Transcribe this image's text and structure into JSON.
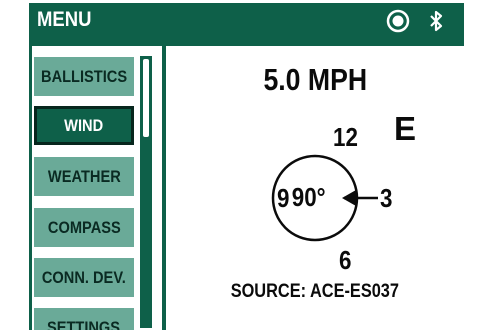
{
  "header": {
    "title": "MENU",
    "icons": [
      "record-icon",
      "bluetooth-icon"
    ]
  },
  "sidebar": {
    "items": [
      {
        "label": "BALLISTICS",
        "selected": false
      },
      {
        "label": "WIND",
        "selected": true
      },
      {
        "label": "WEATHER",
        "selected": false
      },
      {
        "label": "COMPASS",
        "selected": false
      },
      {
        "label": "CONN. DEV.",
        "selected": false
      },
      {
        "label": "SETTINGS",
        "selected": false
      }
    ]
  },
  "wind": {
    "speed": "5.0 MPH",
    "cardinal": "E",
    "clock_top": "12",
    "clock_right": "3",
    "clock_bottom": "6",
    "clock_left": "9",
    "angle": "90°",
    "source": "SOURCE: ACE-ES037"
  },
  "colors": {
    "primary": "#0e6049",
    "menu_item": "#6aaa98",
    "background": "#ffffff"
  }
}
